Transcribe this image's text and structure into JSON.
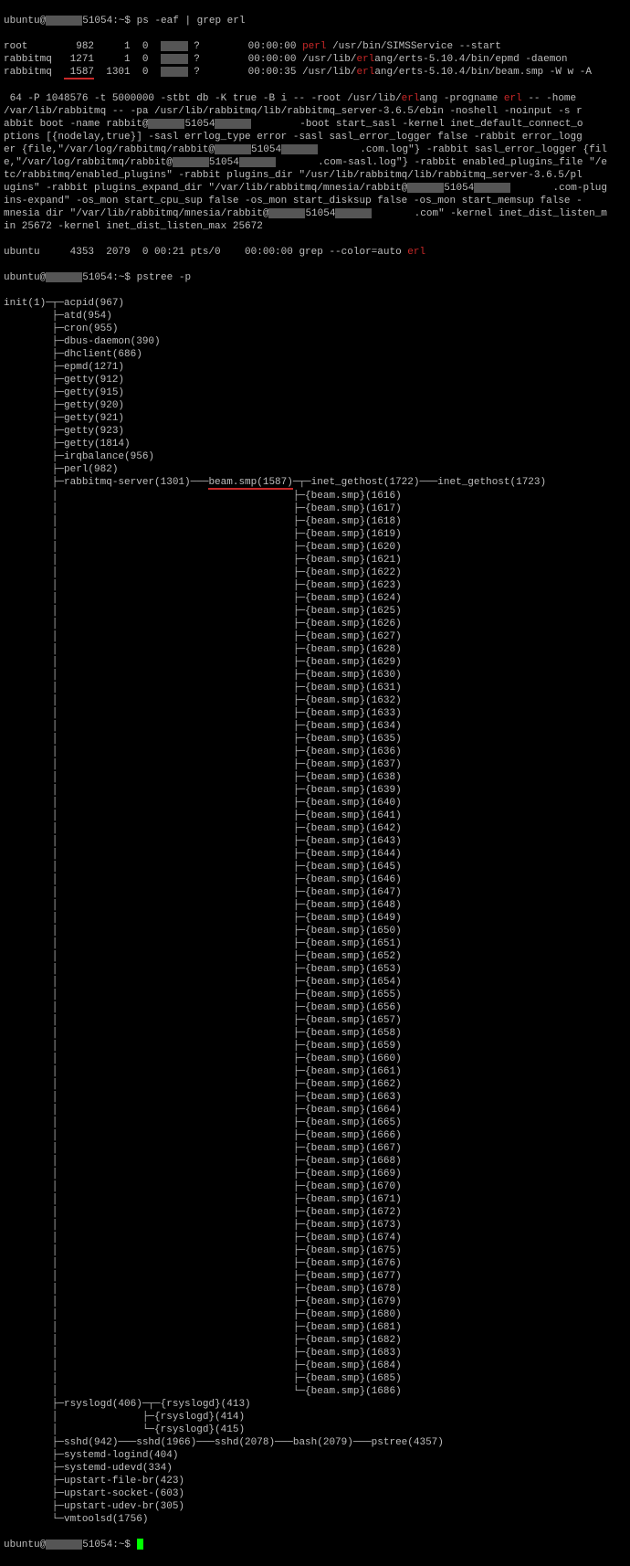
{
  "prompt": {
    "user": "ubuntu@",
    "host_port": "51054",
    "path": ":~$ ",
    "cmd1": "ps -eaf | grep erl",
    "cmd2": "pstree -p"
  },
  "ps": {
    "rows": [
      {
        "user": "root",
        "pid": "982",
        "ppid": "1",
        "c": "0",
        "tty": "?",
        "time": "00:00:00",
        "cmd_pre": "",
        "cmd_hl": "perl",
        "cmd_post": " /usr/bin/SIMSService --start"
      },
      {
        "user": "rabbitmq",
        "pid": "1271",
        "ppid": "1",
        "c": "0",
        "tty": "?",
        "time": "00:00:00",
        "cmd_pre": "/usr/lib/",
        "cmd_hl": "erl",
        "cmd_post": "ang/erts-5.10.4/bin/epmd -daemon"
      },
      {
        "user": "rabbitmq",
        "pid": "1587",
        "ppid": "1301",
        "c": "0",
        "tty": "?",
        "time": "00:00:35",
        "cmd_pre": "/usr/lib/",
        "cmd_hl": "erl",
        "cmd_post": "ang/erts-5.10.4/bin/beam.smp -W w -A"
      }
    ],
    "wrap": " 64 -P 1048576 -t 5000000 -stbt db -K true -B i -- -root /usr/lib/<erl>ang -progname <erl> -- -home\n/var/lib/rabbitmq -- -pa /usr/lib/rabbitmq/lib/rabbitmq_server-3.6.5/ebin -noshell -noinput -s r\nabbit boot -name rabbit@<RED>51054<RED>        -boot start_sasl -kernel inet_default_connect_o\nptions [{nodelay,true}] -sasl errlog_type error -sasl sasl_error_logger false -rabbit error_logg\ner {file,\"/var/log/rabbitmq/rabbit@<RED>51054<RED>       .com.log\"} -rabbit sasl_error_logger {fil\ne,\"/var/log/rabbitmq/rabbit@<RED>51054<RED>       .com-sasl.log\"} -rabbit enabled_plugins_file \"/e\ntc/rabbitmq/enabled_plugins\" -rabbit plugins_dir \"/usr/lib/rabbitmq/lib/rabbitmq_server-3.6.5/pl\nugins\" -rabbit plugins_expand_dir \"/var/lib/rabbitmq/mnesia/rabbit@<RED>51054<RED>       .com-plug\nins-expand\" -os_mon start_cpu_sup false -os_mon start_disksup false -os_mon start_memsup false -\nmnesia dir \"/var/lib/rabbitmq/mnesia/rabbit@<RED>51054<RED>       .com\" -kernel inet_dist_listen_m\nin 25672 -kernel inet_dist_listen_max 25672",
    "last": {
      "user": "ubuntu",
      "pid": "4353",
      "ppid": "2079",
      "c": "0",
      "stime": "00:21",
      "tty": "pts/0",
      "time": "00:00:00",
      "cmd_pre": "grep --color=auto ",
      "cmd_hl": "erl",
      "cmd_post": ""
    }
  },
  "tree": {
    "root": "init(1)",
    "top": [
      "acpid(967)",
      "atd(954)",
      "cron(955)",
      "dbus-daemon(390)",
      "dhclient(686)",
      "epmd(1271)",
      "getty(912)",
      "getty(915)",
      "getty(920)",
      "getty(921)",
      "getty(923)",
      "getty(1814)",
      "irqbalance(956)",
      "perl(982)"
    ],
    "rabbit": {
      "server": "rabbitmq-server(1301)",
      "beam": "beam.smp(1587)",
      "inet1": "inet_gethost(1722)",
      "inet2": "inet_gethost(1723)",
      "threads_start": 1616,
      "threads_end": 1686
    },
    "rsys": {
      "main": "rsyslogd(406)",
      "children": [
        "{rsyslogd}(413)",
        "{rsyslogd}(414)",
        "{rsyslogd}(415)"
      ]
    },
    "sshd": {
      "a": "sshd(942)",
      "b": "sshd(1966)",
      "c": "sshd(2078)",
      "d": "bash(2079)",
      "e": "pstree(4357)"
    },
    "bottom": [
      "systemd-logind(404)",
      "systemd-udevd(334)",
      "upstart-file-br(423)",
      "upstart-socket-(603)",
      "upstart-udev-br(305)",
      "vmtoolsd(1756)"
    ]
  }
}
